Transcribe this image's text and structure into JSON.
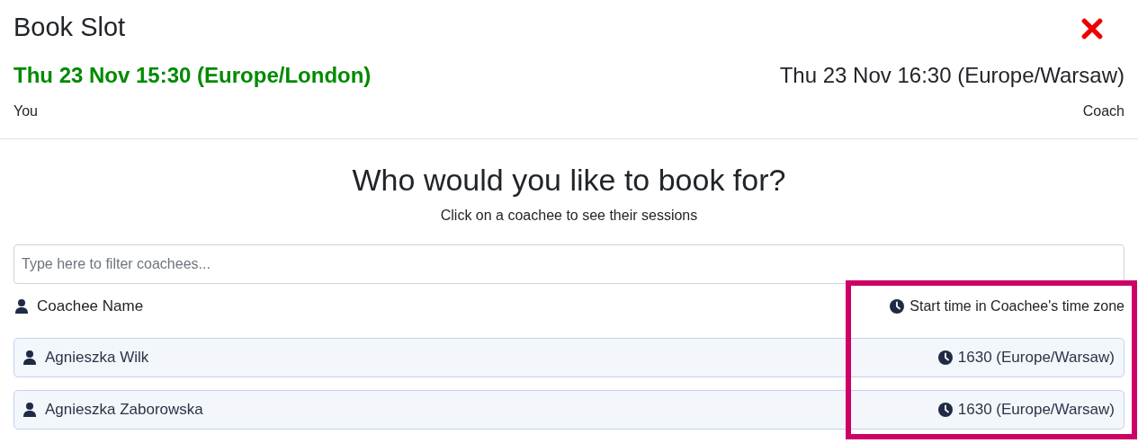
{
  "window": {
    "title": "Book Slot"
  },
  "times": [
    {
      "time": "Thu 23 Nov 15:30 (Europe/London)",
      "label": "You",
      "highlighted": true
    },
    {
      "time": "Thu 23 Nov 16:30 (Europe/Warsaw)",
      "label": "Coach",
      "highlighted": false
    }
  ],
  "heading": "Who would you like to book for?",
  "subheading": "Click on a coachee to see their sessions",
  "filter": {
    "placeholder": "Type here to filter coachees..."
  },
  "columns": [
    "Coachee Name",
    "Start time in Coachee's time zone"
  ],
  "rows": [
    {
      "name": "Agnieszka Wilk",
      "start": "1630 (Europe/Warsaw)"
    },
    {
      "name": "Agnieszka Zaborowska",
      "start": "1630 (Europe/Warsaw)"
    }
  ]
}
